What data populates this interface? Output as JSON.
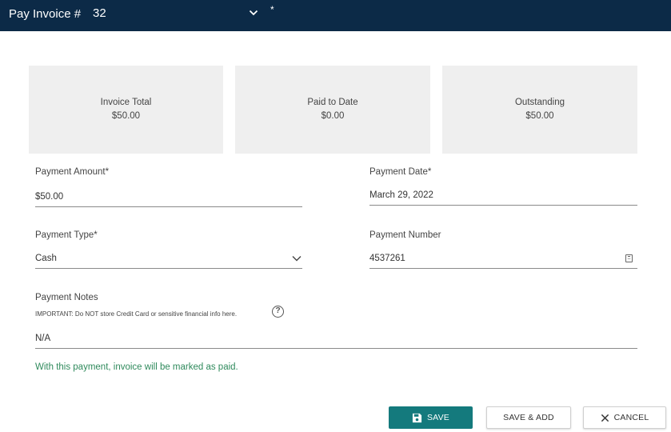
{
  "header": {
    "title": "Pay Invoice #",
    "invoice_number": "32",
    "dirty_marker": "*"
  },
  "summary": [
    {
      "label": "Invoice Total",
      "value": "$50.00"
    },
    {
      "label": "Paid to Date",
      "value": "$0.00"
    },
    {
      "label": "Outstanding",
      "value": "$50.00"
    }
  ],
  "form": {
    "payment_amount": {
      "label": "Payment Amount*",
      "value": "$50.00"
    },
    "payment_date": {
      "label": "Payment Date*",
      "value": "March 29, 2022"
    },
    "payment_type": {
      "label": "Payment Type*",
      "value": "Cash"
    },
    "payment_number": {
      "label": "Payment Number",
      "value": "4537261"
    },
    "payment_notes": {
      "label": "Payment Notes",
      "hint": "IMPORTANT: Do NOT store Credit Card or sensitive financial info here.",
      "value": "N/A"
    }
  },
  "status_message": "With this payment, invoice will be marked as paid.",
  "actions": {
    "save": "SAVE",
    "save_add": "SAVE & ADD",
    "cancel": "CANCEL"
  },
  "colors": {
    "header_bg": "#0c2a47",
    "primary": "#147a7d",
    "success_text": "#2f8a5c"
  },
  "icons": {
    "invoice_dropdown": "chevron-down-icon",
    "type_dropdown": "chevron-down-icon",
    "number_action": "calculator-icon",
    "help": "help-circle-icon",
    "save": "floppy-disk-icon",
    "cancel": "close-icon"
  }
}
